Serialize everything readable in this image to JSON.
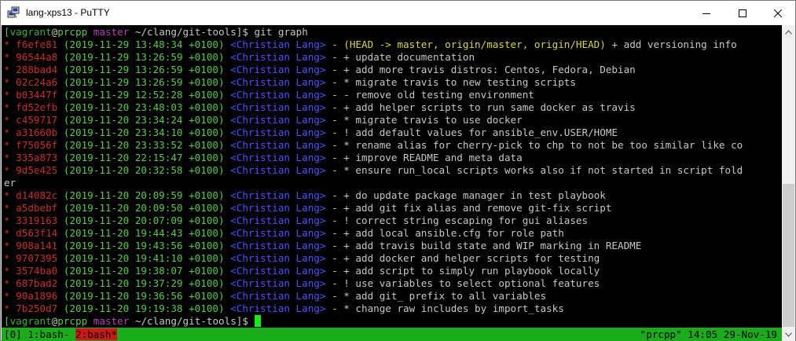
{
  "window": {
    "title": "lang-xps13 - PuTTY"
  },
  "prompt": {
    "user": "vagrant",
    "at": "@",
    "host": "prcpp",
    "branch": "master",
    "path": "~/clang/git-tools]$",
    "command": "git graph"
  },
  "commits": [
    {
      "hash": "f6efe81",
      "date": "(2019-11-29 13:48:34 +0100)",
      "author": "<Christian Lang>",
      "refs": "(HEAD -> master, origin/master, origin/HEAD)",
      "msg": " + add versioning info"
    },
    {
      "hash": "96544a8",
      "date": "(2019-11-29 13:26:59 +0100)",
      "author": "<Christian Lang>",
      "refs": "",
      "msg": "+ update documentation"
    },
    {
      "hash": "288bad4",
      "date": "(2019-11-29 13:26:59 +0100)",
      "author": "<Christian Lang>",
      "refs": "",
      "msg": "+ add more travis distros: Centos, Fedora, Debian"
    },
    {
      "hash": "02c24a6",
      "date": "(2019-11-29 13:26:59 +0100)",
      "author": "<Christian Lang>",
      "refs": "",
      "msg": "* migrate travis to new testing scripts"
    },
    {
      "hash": "b03447f",
      "date": "(2019-11-29 12:52:28 +0100)",
      "author": "<Christian Lang>",
      "refs": "",
      "msg": "- remove old testing environment"
    },
    {
      "hash": "fd52efb",
      "date": "(2019-11-20 23:48:03 +0100)",
      "author": "<Christian Lang>",
      "refs": "",
      "msg": "+ add helper scripts to run same docker as travis"
    },
    {
      "hash": "c459717",
      "date": "(2019-11-20 23:34:24 +0100)",
      "author": "<Christian Lang>",
      "refs": "",
      "msg": "* migrate travis to use docker"
    },
    {
      "hash": "a31660b",
      "date": "(2019-11-20 23:34:10 +0100)",
      "author": "<Christian Lang>",
      "refs": "",
      "msg": "! add default values for ansible_env.USER/HOME"
    },
    {
      "hash": "f75056f",
      "date": "(2019-11-20 23:33:52 +0100)",
      "author": "<Christian Lang>",
      "refs": "",
      "msg": "* rename alias for cherry-pick to chp to not be too similar like co"
    },
    {
      "hash": "335a873",
      "date": "(2019-11-20 22:15:47 +0100)",
      "author": "<Christian Lang>",
      "refs": "",
      "msg": "+ improve README and meta data"
    },
    {
      "hash": "9d5e425",
      "date": "(2019-11-20 20:32:58 +0100)",
      "author": "<Christian Lang>",
      "refs": "",
      "msg": "* ensure run_local scripts works also if not started in script fold",
      "wrap": "er"
    },
    {
      "hash": "d14082c",
      "date": "(2019-11-20 20:09:59 +0100)",
      "author": "<Christian Lang>",
      "refs": "",
      "msg": "+ do update package manager in test playbook"
    },
    {
      "hash": "a5dbebf",
      "date": "(2019-11-20 20:09:50 +0100)",
      "author": "<Christian Lang>",
      "refs": "",
      "msg": "+ add git fix alias and remove git-fix script"
    },
    {
      "hash": "3319163",
      "date": "(2019-11-20 20:07:09 +0100)",
      "author": "<Christian Lang>",
      "refs": "",
      "msg": "! correct string escaping for gui aliases"
    },
    {
      "hash": "d563f14",
      "date": "(2019-11-20 19:44:43 +0100)",
      "author": "<Christian Lang>",
      "refs": "",
      "msg": "+ add local ansible.cfg for role path"
    },
    {
      "hash": "908a141",
      "date": "(2019-11-20 19:43:56 +0100)",
      "author": "<Christian Lang>",
      "refs": "",
      "msg": "+ add travis build state and WIP marking in README"
    },
    {
      "hash": "9707395",
      "date": "(2019-11-20 19:41:10 +0100)",
      "author": "<Christian Lang>",
      "refs": "",
      "msg": "+ add docker and helper scripts for testing"
    },
    {
      "hash": "3574ba0",
      "date": "(2019-11-20 19:38:07 +0100)",
      "author": "<Christian Lang>",
      "refs": "",
      "msg": "+ add script to simply run playbook locally"
    },
    {
      "hash": "687bad2",
      "date": "(2019-11-20 19:37:29 +0100)",
      "author": "<Christian Lang>",
      "refs": "",
      "msg": "! use variables to select optional features"
    },
    {
      "hash": "90a1896",
      "date": "(2019-11-20 19:36:56 +0100)",
      "author": "<Christian Lang>",
      "refs": "",
      "msg": "* add git_ prefix to all variables"
    },
    {
      "hash": "7b250d7",
      "date": "(2019-11-20 19:19:38 +0100)",
      "author": "<Christian Lang>",
      "refs": "",
      "msg": "* change raw includes by import_tasks"
    }
  ],
  "status": {
    "session": "[0]",
    "win1": " 1:bash-",
    "win2": "2:bash*",
    "right": "\"prcpp\" 14:05 29-Nov-19"
  },
  "colors": {
    "terminal_bg": "#000000",
    "status_bg": "#1aac1a",
    "active_window_bg": "#cc1818",
    "cursor": "#11ee11"
  }
}
